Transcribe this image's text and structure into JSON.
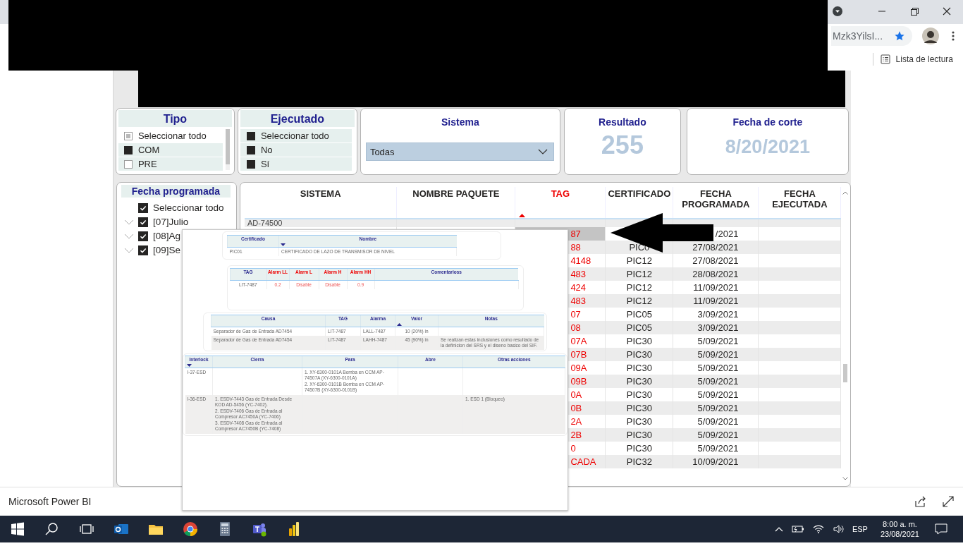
{
  "browser": {
    "address_fragment": "Mzk3YilsI...",
    "reading_list": "Lista de lectura"
  },
  "tipo": {
    "title": "Tipo",
    "items": [
      {
        "label": "Seleccionar todo",
        "partial": true
      },
      {
        "label": "COM",
        "checked": true,
        "partial": false
      },
      {
        "label": "PRE",
        "checked": false,
        "partial": false
      }
    ]
  },
  "ejecutado": {
    "title": "Ejecutado",
    "items": [
      {
        "label": "Seleccionar todo",
        "checked": true
      },
      {
        "label": "No",
        "checked": true
      },
      {
        "label": "Sí",
        "checked": true
      }
    ]
  },
  "sistema": {
    "title": "Sistema",
    "value": "Todas"
  },
  "resultado": {
    "title": "Resultado",
    "value": "255"
  },
  "fecha_de_corte": {
    "title": "Fecha de corte",
    "value": "8/20/2021"
  },
  "fecha_programada": {
    "title": "Fecha programada",
    "items": [
      {
        "label": "Seleccionar todo",
        "checked": true
      },
      {
        "label": "[07]Julio",
        "checked": true,
        "expanded": false
      },
      {
        "label": "[08]Ag",
        "checked": true,
        "expanded": false
      },
      {
        "label": "[09]Se",
        "checked": true,
        "expanded": false
      }
    ]
  },
  "table": {
    "columns": [
      {
        "label": "SISTEMA",
        "sorted": false
      },
      {
        "label": "NOMBRE PAQUETE",
        "sorted": false
      },
      {
        "label": "TAG",
        "sorted": true,
        "descending": false
      },
      {
        "label": "CERTIFICADO",
        "sorted": false
      },
      {
        "label": "FECHA PROGRAMADA",
        "sorted": false
      },
      {
        "label": "FECHA EJECUTADA",
        "sorted": false
      }
    ],
    "rows": [
      {
        "sistema": "AD-74500",
        "selected": false
      },
      {
        "tag": "87",
        "fecha_programada": "/2021",
        "selected": true
      },
      {
        "tag": "88",
        "certificado": "PIC0",
        "fecha_programada": "27/08/2021",
        "selected": false
      },
      {
        "tag": "4148",
        "certificado": "PIC12",
        "fecha_programada": "27/08/2021",
        "selected": false
      },
      {
        "tag": "483",
        "certificado": "PIC12",
        "fecha_programada": "28/08/2021",
        "selected": false
      },
      {
        "tag": "424",
        "certificado": "PIC12",
        "fecha_programada": "11/09/2021",
        "selected": false
      },
      {
        "tag": "483",
        "certificado": "PIC12",
        "fecha_programada": "11/09/2021",
        "selected": false
      },
      {
        "tag": "07",
        "certificado": "PIC05",
        "fecha_programada": "3/09/2021",
        "selected": false
      },
      {
        "tag": "08",
        "certificado": "PIC05",
        "fecha_programada": "3/09/2021",
        "selected": false
      },
      {
        "tag": "07A",
        "certificado": "PIC30",
        "fecha_programada": "5/09/2021",
        "selected": false
      },
      {
        "tag": "07B",
        "certificado": "PIC30",
        "fecha_programada": "5/09/2021",
        "selected": false
      },
      {
        "tag": "09A",
        "certificado": "PIC30",
        "fecha_programada": "5/09/2021",
        "selected": false
      },
      {
        "tag": "09B",
        "certificado": "PIC30",
        "fecha_programada": "5/09/2021",
        "selected": false
      },
      {
        "tag": "0A",
        "certificado": "PIC30",
        "fecha_programada": "5/09/2021",
        "selected": false
      },
      {
        "tag": "0B",
        "certificado": "PIC30",
        "fecha_programada": "5/09/2021",
        "selected": false
      },
      {
        "tag": "2A",
        "certificado": "PIC30",
        "fecha_programada": "5/09/2021",
        "selected": false
      },
      {
        "tag": "2B",
        "certificado": "PIC30",
        "fecha_programada": "5/09/2021",
        "selected": false
      },
      {
        "tag": "0",
        "certificado": "PIC30",
        "fecha_programada": "5/09/2021",
        "selected": false
      },
      {
        "tag": "CADA",
        "certificado": "PIC32",
        "fecha_programada": "10/09/2021",
        "selected": false
      }
    ]
  },
  "popup": {
    "tables": [
      {
        "kind": "certificado",
        "columns": [
          {
            "label": "Certificado",
            "alert": false,
            "sorted": false
          },
          {
            "label": "Nombre",
            "alert": false,
            "sorted": true,
            "descending": true
          }
        ],
        "rows": [
          {
            "certificado": "PIC01",
            "nombre": "CERTIFICADO DE LAZO DE TRANSMISOR DE NIVEL"
          }
        ]
      },
      {
        "kind": "alarmas",
        "columns": [
          {
            "label": "TAG",
            "alert": false,
            "sorted": false
          },
          {
            "label": "Alarm LL",
            "alert": true,
            "sorted": false
          },
          {
            "label": "Alarm L",
            "alert": true,
            "sorted": false
          },
          {
            "label": "Alarm H",
            "alert": true,
            "sorted": false
          },
          {
            "label": "Alarm HH",
            "alert": true,
            "sorted": false
          },
          {
            "label": "Comentarioss",
            "alert": false,
            "sorted": false
          }
        ],
        "rows": [
          {
            "tag": "LIT-7487",
            "alarm_ll": "0.2",
            "alarm_l": "Disable",
            "alarm_h": "Disable",
            "alarm_hh": "0.9"
          }
        ]
      },
      {
        "kind": "causas",
        "columns": [
          {
            "label": "Causa",
            "alert": false,
            "sorted": false
          },
          {
            "label": "TAG",
            "alert": false,
            "sorted": false
          },
          {
            "label": "Alarma",
            "alert": false,
            "sorted": false
          },
          {
            "label": "Valor",
            "alert": false,
            "sorted": true,
            "descending": false
          },
          {
            "label": "Notas",
            "alert": false,
            "sorted": false
          }
        ],
        "rows": [
          {
            "causa": "Separador de Gas de Entrada AD7454",
            "tag": "LIT-7487",
            "alarma": "LALL-7487",
            "valor": "10 (20%) in"
          },
          {
            "causa": "Separador de Gas de Entrada AD7454",
            "tag": "LIT-7487",
            "alarma": "LAHH-7487",
            "valor": "45 (90%) in",
            "notas": "Se realizan estas inclusiones como resultado de la definicion del SRS y el diseno basico del SIF."
          }
        ]
      },
      {
        "kind": "interlocks",
        "columns": [
          {
            "label": "Interlock",
            "alert": false,
            "sorted": true,
            "descending": true
          },
          {
            "label": "Cierra",
            "alert": false,
            "sorted": false
          },
          {
            "label": "Para",
            "alert": false,
            "sorted": false
          },
          {
            "label": "Abre",
            "alert": false,
            "sorted": false
          },
          {
            "label": "Otras acciones",
            "alert": false,
            "sorted": false
          }
        ],
        "rows": [
          {
            "interlock": "I-37-ESD",
            "para": [
              "1. XY-6300-0101A Bomba en CCM AP-74507A (XY-6300-0101A)",
              "2. XY-6300-0101B Bomba en CCM AP-74507B (XY-6300-0101B)"
            ]
          },
          {
            "interlock": "I-36-ESD",
            "cierra": [
              "1. ESDV-7443 Gas de Entrada Desde KOD AD-5456 (YC-7402).",
              "2. ESDV-7406 Gas de Entrada al Compresor AC7450A (YC-7406)",
              "3. ESDV-7408 Gas de Entrada al Compresor AC7450B (YC-7408)"
            ],
            "otras_acciones": [
              "1. ESD 1 (Bloqueo)"
            ]
          }
        ]
      }
    ]
  },
  "footer": {
    "app_name": "Microsoft Power BI"
  },
  "taskbar": {
    "language": "ESP",
    "time": "8:00 a. m.",
    "date": "23/08/2021"
  }
}
